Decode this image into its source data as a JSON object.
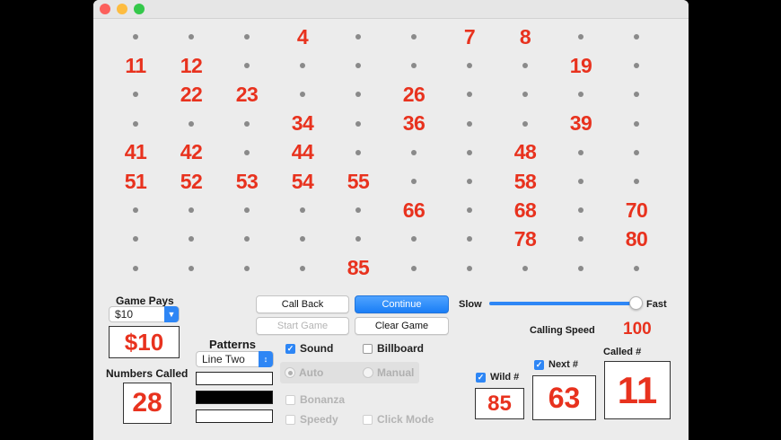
{
  "window": {
    "traffic_lights": [
      {
        "name": "close",
        "color": "#fc605c"
      },
      {
        "name": "minimize",
        "color": "#fdbc40"
      },
      {
        "name": "zoom",
        "color": "#34c84a"
      }
    ]
  },
  "board": {
    "columns": 10,
    "rows": 9,
    "called_color": "#e8321e",
    "rows_cells": [
      [
        "",
        "",
        "",
        "4",
        "",
        "",
        "7",
        "8",
        "",
        ""
      ],
      [
        "11",
        "12",
        "",
        "",
        "",
        "",
        "",
        "",
        "19",
        ""
      ],
      [
        "",
        "22",
        "23",
        "",
        "",
        "26",
        "",
        "",
        "",
        ""
      ],
      [
        "",
        "",
        "",
        "34",
        "",
        "36",
        "",
        "",
        "39",
        ""
      ],
      [
        "41",
        "42",
        "",
        "44",
        "",
        "",
        "",
        "48",
        "",
        ""
      ],
      [
        "51",
        "52",
        "53",
        "54",
        "55",
        "",
        "",
        "58",
        "",
        ""
      ],
      [
        "",
        "",
        "",
        "",
        "",
        "66",
        "",
        "68",
        "",
        "70"
      ],
      [
        "",
        "",
        "",
        "",
        "",
        "",
        "",
        "78",
        "",
        "80"
      ],
      [
        "",
        "",
        "",
        "",
        "85",
        "",
        "",
        "",
        "",
        ""
      ]
    ]
  },
  "game_pays": {
    "label": "Game Pays",
    "selected": "$10",
    "display": "$10"
  },
  "numbers_called": {
    "label": "Numbers Called",
    "value": "28"
  },
  "patterns": {
    "label": "Patterns",
    "selected": "Line Two",
    "swatches": [
      "#ffffff",
      "#000000",
      "#ffffff"
    ]
  },
  "buttons": {
    "call_back": "Call Back",
    "continue": "Continue",
    "start_game": "Start Game",
    "clear_game": "Clear Game"
  },
  "options": {
    "sound": {
      "label": "Sound",
      "checked": true
    },
    "billboard": {
      "label": "Billboard",
      "checked": false
    },
    "auto": {
      "label": "Auto",
      "selected": true
    },
    "manual": {
      "label": "Manual",
      "selected": false
    },
    "bonanza": {
      "label": "Bonanza",
      "checked": false
    },
    "speedy": {
      "label": "Speedy",
      "checked": false
    },
    "click_mode": {
      "label": "Click Mode",
      "checked": false
    }
  },
  "speed": {
    "slow_label": "Slow",
    "fast_label": "Fast",
    "calling_speed_label": "Calling Speed",
    "value": "100",
    "level": 1.0
  },
  "wild": {
    "label": "Wild #",
    "checked": true,
    "value": "85"
  },
  "next": {
    "label": "Next #",
    "checked": true,
    "value": "63"
  },
  "called": {
    "label": "Called #",
    "value": "11"
  }
}
